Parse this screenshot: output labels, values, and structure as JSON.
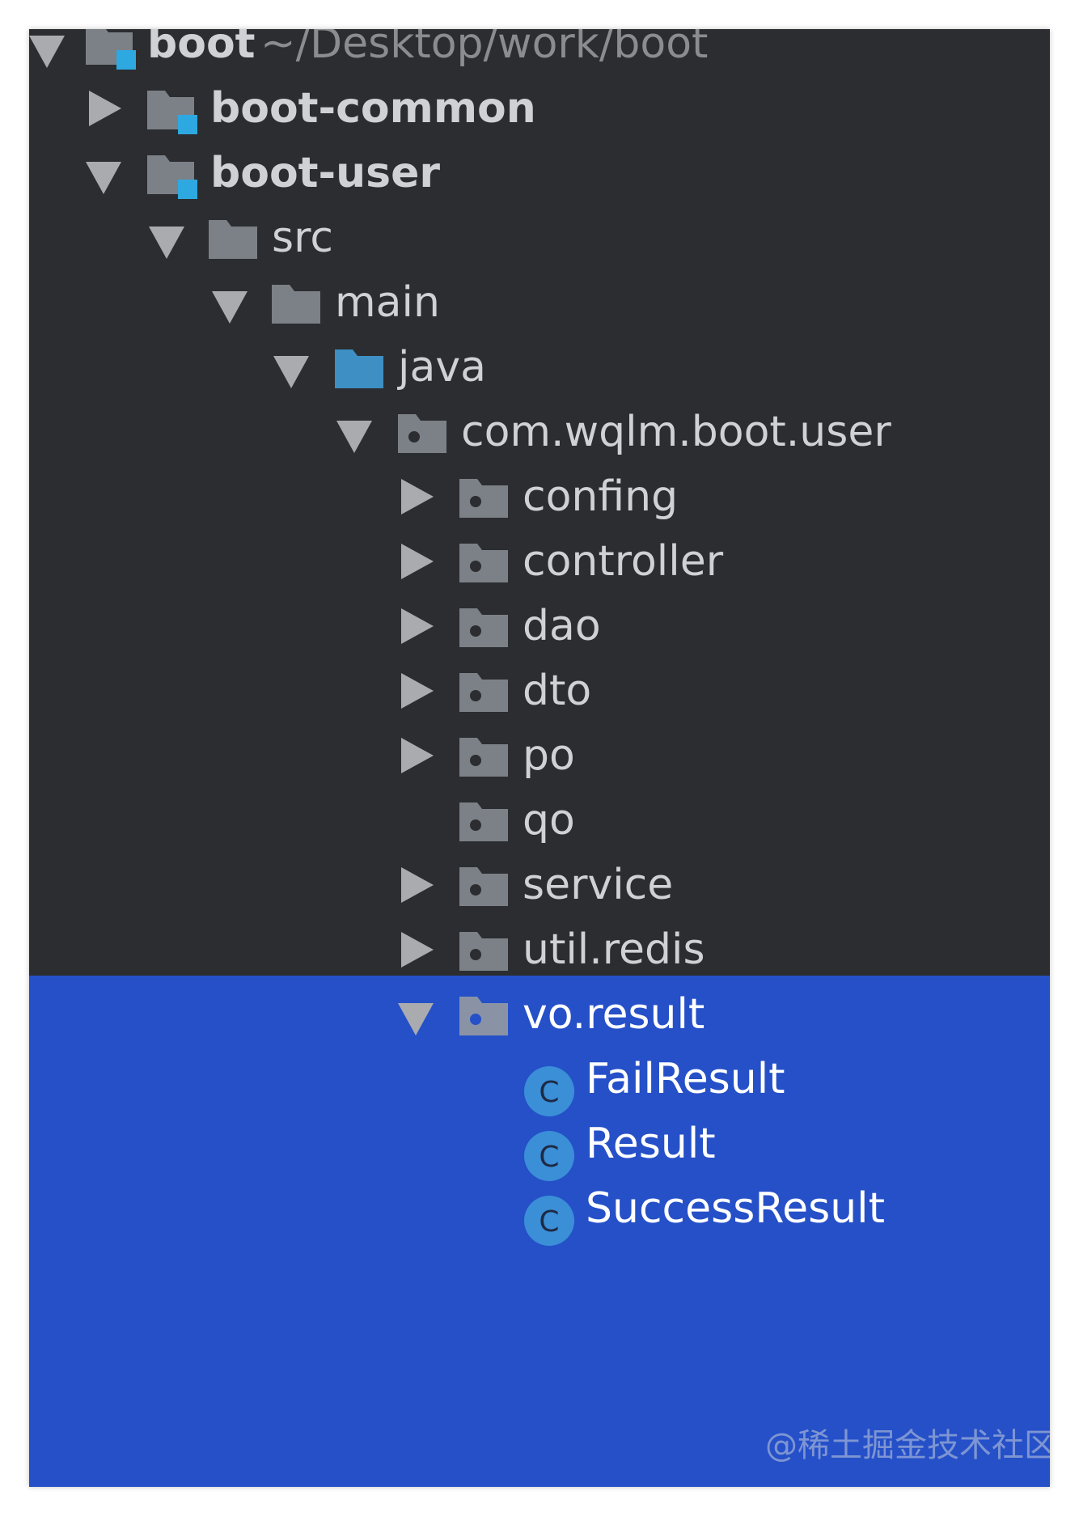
{
  "tree": {
    "root": {
      "name": "boot",
      "path": "~/Desktop/work/boot"
    },
    "modules": {
      "common": "boot-common",
      "user": "boot-user"
    },
    "src": "src",
    "main": "main",
    "java": "java",
    "package": "com.wqlm.boot.user",
    "subpackages": {
      "config": "confing",
      "controller": "controller",
      "dao": "dao",
      "dto": "dto",
      "po": "po",
      "qo": "qo",
      "service": "service",
      "util_redis": "util.redis",
      "vo_result": "vo.result"
    },
    "classes": {
      "fail": "FailResult",
      "result": "Result",
      "success": "SuccessResult"
    },
    "class_badge": "C"
  },
  "watermark": "@稀土掘金技术社区",
  "colors": {
    "background": "#2b2d30",
    "selection": "#2550c8",
    "text": "#cfd1d4",
    "path_text": "#8a8c90",
    "folder": "#7c8187",
    "source_folder": "#3d8fc4",
    "module_badge": "#2ea8e0",
    "class_icon": "#3a8fd6"
  },
  "icons": {
    "module": "module-folder-icon",
    "folder": "folder-icon",
    "source_folder": "source-folder-icon",
    "package": "package-icon",
    "class": "class-icon",
    "expanded": "chevron-down-icon",
    "collapsed": "chevron-right-icon"
  }
}
